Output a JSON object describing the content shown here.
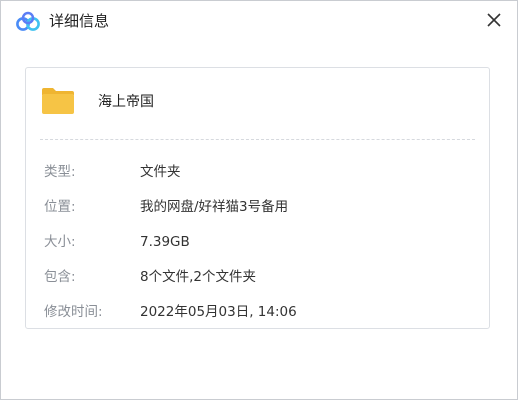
{
  "window": {
    "title": "详细信息"
  },
  "icons": {
    "app": "baidu-netdisk-cloud-icon",
    "close": "close-icon",
    "folder": "folder-icon"
  },
  "colors": {
    "folder": "#f6c445",
    "folder_tab": "#efb531",
    "app_icon_left": "#4a8cf7",
    "app_icon_right": "#3fc1f0"
  },
  "item": {
    "name": "海上帝国"
  },
  "details": [
    {
      "label": "类型:",
      "value": "文件夹"
    },
    {
      "label": "位置:",
      "value": "我的网盘/好祥猫3号备用"
    },
    {
      "label": "大小:",
      "value": "7.39GB"
    },
    {
      "label": "包含:",
      "value": "8个文件,2个文件夹"
    },
    {
      "label": "修改时间:",
      "value": "2022年05月03日, 14:06"
    }
  ]
}
